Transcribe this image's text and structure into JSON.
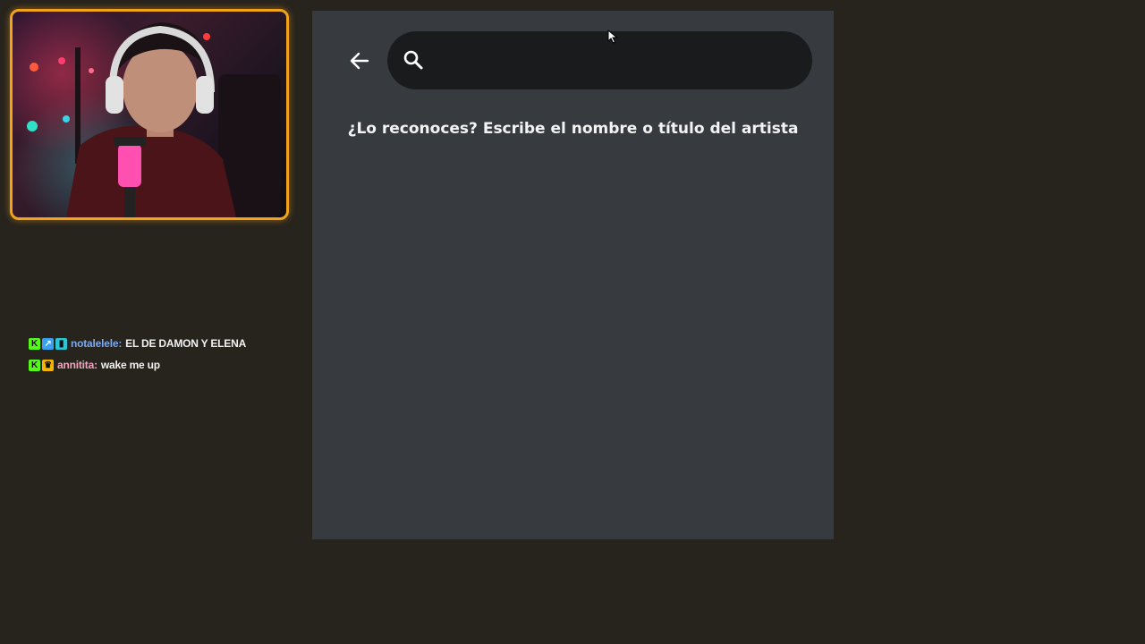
{
  "webcam": {
    "border_color": "#f2a31b"
  },
  "chat": {
    "messages": [
      {
        "badges": [
          "kick-icon",
          "verified-icon",
          "subscriber-icon"
        ],
        "username": "notalelele:",
        "text": "EL DE DAMON Y ELENA",
        "username_color": "#7fa9ea"
      },
      {
        "badges": [
          "kick-icon",
          "crown-icon"
        ],
        "username": "annitita:",
        "text": "wake me up",
        "username_color": "#f0a7c2"
      }
    ]
  },
  "panel": {
    "back_icon": "arrow-left-icon",
    "search": {
      "icon": "search-icon",
      "value": "",
      "placeholder": ""
    },
    "prompt": "¿Lo reconoces? Escribe el nombre o título del artista"
  },
  "colors": {
    "background": "#27231d",
    "panel": "#373b40",
    "search_bar": "#1a1b1c",
    "accent": "#f2a31b"
  }
}
